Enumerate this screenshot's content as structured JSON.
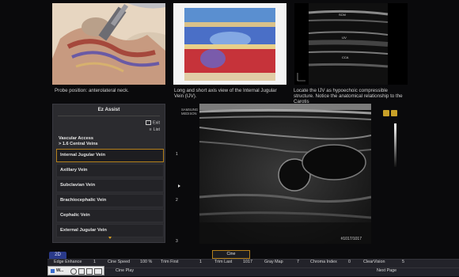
{
  "reference": {
    "captions": [
      "Probe position: anterolateral neck.",
      "Long and short axis view of the Internal Jugular Vein (IJV).",
      "Locate the IJV as hypoechoic compressible structure. Notice the anatomical relationship to the Carotis"
    ],
    "us_labels": [
      "SCM",
      "IJV",
      "CCA"
    ]
  },
  "ez_assist": {
    "title": "Ez Assist",
    "exit_label": "Exit",
    "list_label": "List",
    "path_line1": "Vascular Access",
    "path_line2": "> 1.6 Central Veins",
    "veins": [
      "Internal Jugular Vein",
      "Axillary Vein",
      "Subclavian Vein",
      "Brachiocephalic Vein",
      "Cephalic Vein",
      "External Jugular Vein"
    ],
    "selected_index": 0
  },
  "ultrasound": {
    "brand": "SAMSUNG",
    "model": "MEDISON",
    "depth_marks": [
      "1",
      "2",
      "3"
    ],
    "frame_counter": "#1017/1017",
    "cine_label": "Cine"
  },
  "bottom_bar": {
    "mode_label": "2D",
    "row1": [
      {
        "label": "Edge Enhance",
        "value": "1"
      },
      {
        "label": "Cine Speed",
        "value": "100 %"
      },
      {
        "label": "Trim First",
        "value": "1"
      },
      {
        "label": "Trim Last",
        "value": "1017"
      },
      {
        "label": "Gray Map",
        "value": "7"
      },
      {
        "label": "Chroma Index",
        "value": "0"
      },
      {
        "label": "ClearVision",
        "value": "5"
      }
    ],
    "row2": {
      "cine_play": "Cine Play",
      "next_page": "Next Page"
    },
    "taskbar_label": "W..."
  },
  "colors": {
    "accent": "#d8a020",
    "selection_border": "#b4801c",
    "background": "#0a0a0c"
  }
}
